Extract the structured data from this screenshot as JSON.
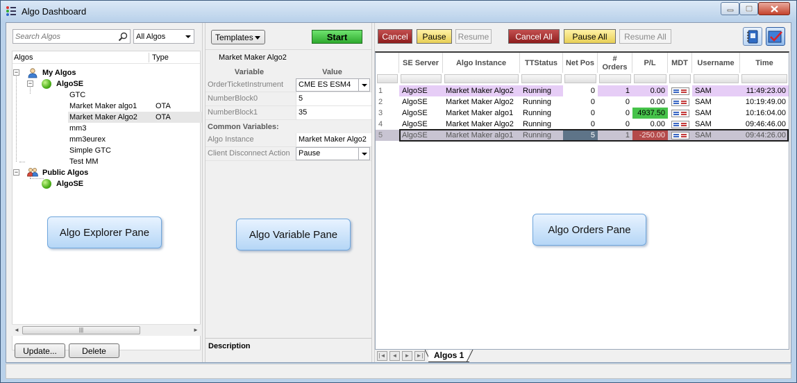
{
  "window": {
    "title": "Algo Dashboard"
  },
  "explorer": {
    "search_placeholder": "Search Algos",
    "filter_value": "All Algos",
    "col_algos": "Algos",
    "col_type": "Type",
    "tree": {
      "my_algos": "My Algos",
      "algose": "AlgoSE",
      "items": [
        {
          "name": "GTC",
          "type": ""
        },
        {
          "name": "Market Maker algo1",
          "type": "OTA"
        },
        {
          "name": "Market Maker Algo2",
          "type": "OTA"
        },
        {
          "name": "mm3",
          "type": ""
        },
        {
          "name": "mm3eurex",
          "type": ""
        },
        {
          "name": "Simple GTC",
          "type": ""
        },
        {
          "name": "Test MM",
          "type": ""
        }
      ],
      "public_algos": "Public Algos",
      "public_algose": "AlgoSE"
    },
    "update_label": "Update...",
    "delete_label": "Delete",
    "callout": "Algo Explorer Pane"
  },
  "variables": {
    "templates_label": "Templates",
    "start_label": "Start",
    "algo_name": "Market Maker Algo2",
    "col_variable": "Variable",
    "col_value": "Value",
    "rows": [
      {
        "name": "OrderTicketInstrument",
        "value": "CME ES ESM4"
      },
      {
        "name": "NumberBlock0",
        "value": "5"
      },
      {
        "name": "NumberBlock1",
        "value": "35"
      }
    ],
    "common_title": "Common Variables:",
    "common_rows": [
      {
        "name": "Algo Instance",
        "value": "Market Maker Algo2"
      },
      {
        "name": "Client Disconnect Action",
        "value": "Pause"
      }
    ],
    "description_label": "Description",
    "callout": "Algo Variable Pane"
  },
  "orders": {
    "buttons": {
      "cancel": "Cancel",
      "pause": "Pause",
      "resume": "Resume",
      "cancel_all": "Cancel All",
      "pause_all": "Pause All",
      "resume_all": "Resume All"
    },
    "columns": [
      "SE Server",
      "Algo Instance",
      "TTStatus",
      "Net Pos",
      "# Orders",
      "P/L",
      "MDT",
      "Username",
      "Time"
    ],
    "rows": [
      {
        "idx": "1",
        "server": "AlgoSE",
        "instance": "Market Maker Algo2",
        "status": "Running",
        "netpos": "0",
        "orders": "1",
        "pl": "0.00",
        "user": "SAM",
        "time": "11:49:23.00"
      },
      {
        "idx": "2",
        "server": "AlgoSE",
        "instance": "Market Maker Algo2",
        "status": "Running",
        "netpos": "0",
        "orders": "0",
        "pl": "0.00",
        "user": "SAM",
        "time": "10:19:49.00"
      },
      {
        "idx": "3",
        "server": "AlgoSE",
        "instance": "Market Maker algo1",
        "status": "Running",
        "netpos": "0",
        "orders": "0",
        "pl": "4937.50",
        "user": "SAM",
        "time": "10:16:04.00"
      },
      {
        "idx": "4",
        "server": "AlgoSE",
        "instance": "Market Maker Algo2",
        "status": "Running",
        "netpos": "0",
        "orders": "0",
        "pl": "0.00",
        "user": "SAM",
        "time": "09:46:46.00"
      },
      {
        "idx": "5",
        "server": "AlgoSE",
        "instance": "Market Maker algo1",
        "status": "Running",
        "netpos": "5",
        "orders": "1",
        "pl": "-250.00",
        "user": "SAM",
        "time": "09:44:26.00"
      }
    ],
    "tab_label": "Algos 1",
    "callout": "Algo Orders Pane"
  },
  "colors": {
    "row_highlight": "#e6cdf6",
    "pl_positive": "#46c34a",
    "pl_negative": "#b44a4a",
    "selected_row": "#c8c4d2"
  }
}
